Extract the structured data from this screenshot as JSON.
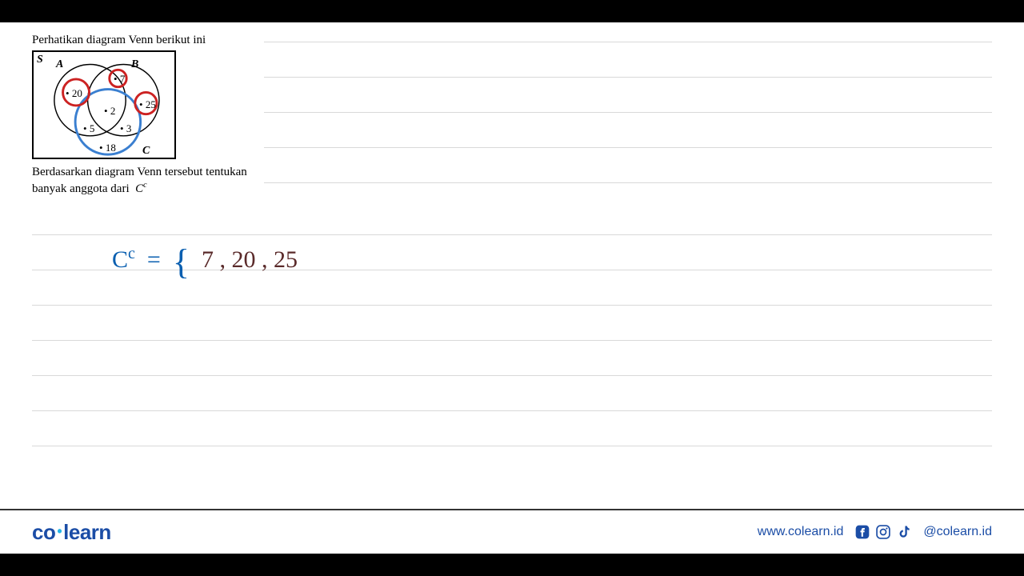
{
  "problem": {
    "title": "Perhatikan diagram Venn berikut ini",
    "labels": {
      "S": "S",
      "A": "A",
      "B": "B",
      "C": "C"
    },
    "numbers": {
      "n20": "20",
      "n7": "7",
      "n25": "25",
      "n2": "2",
      "n5": "5",
      "n3": "3",
      "n18": "18"
    },
    "text1": "Berdasarkan diagram Venn tersebut tentukan",
    "text2_prefix": "banyak anggota dari",
    "text2_var": "C",
    "text2_sup": "c"
  },
  "answer": {
    "lhs_var": "C",
    "lhs_sup": "c",
    "equals": "=",
    "brace": "{",
    "values": "7 ,  20 ,  25"
  },
  "footer": {
    "logo_1": "co",
    "logo_dot": "•",
    "logo_2": "learn",
    "url": "www.colearn.id",
    "handle": "@colearn.id"
  }
}
